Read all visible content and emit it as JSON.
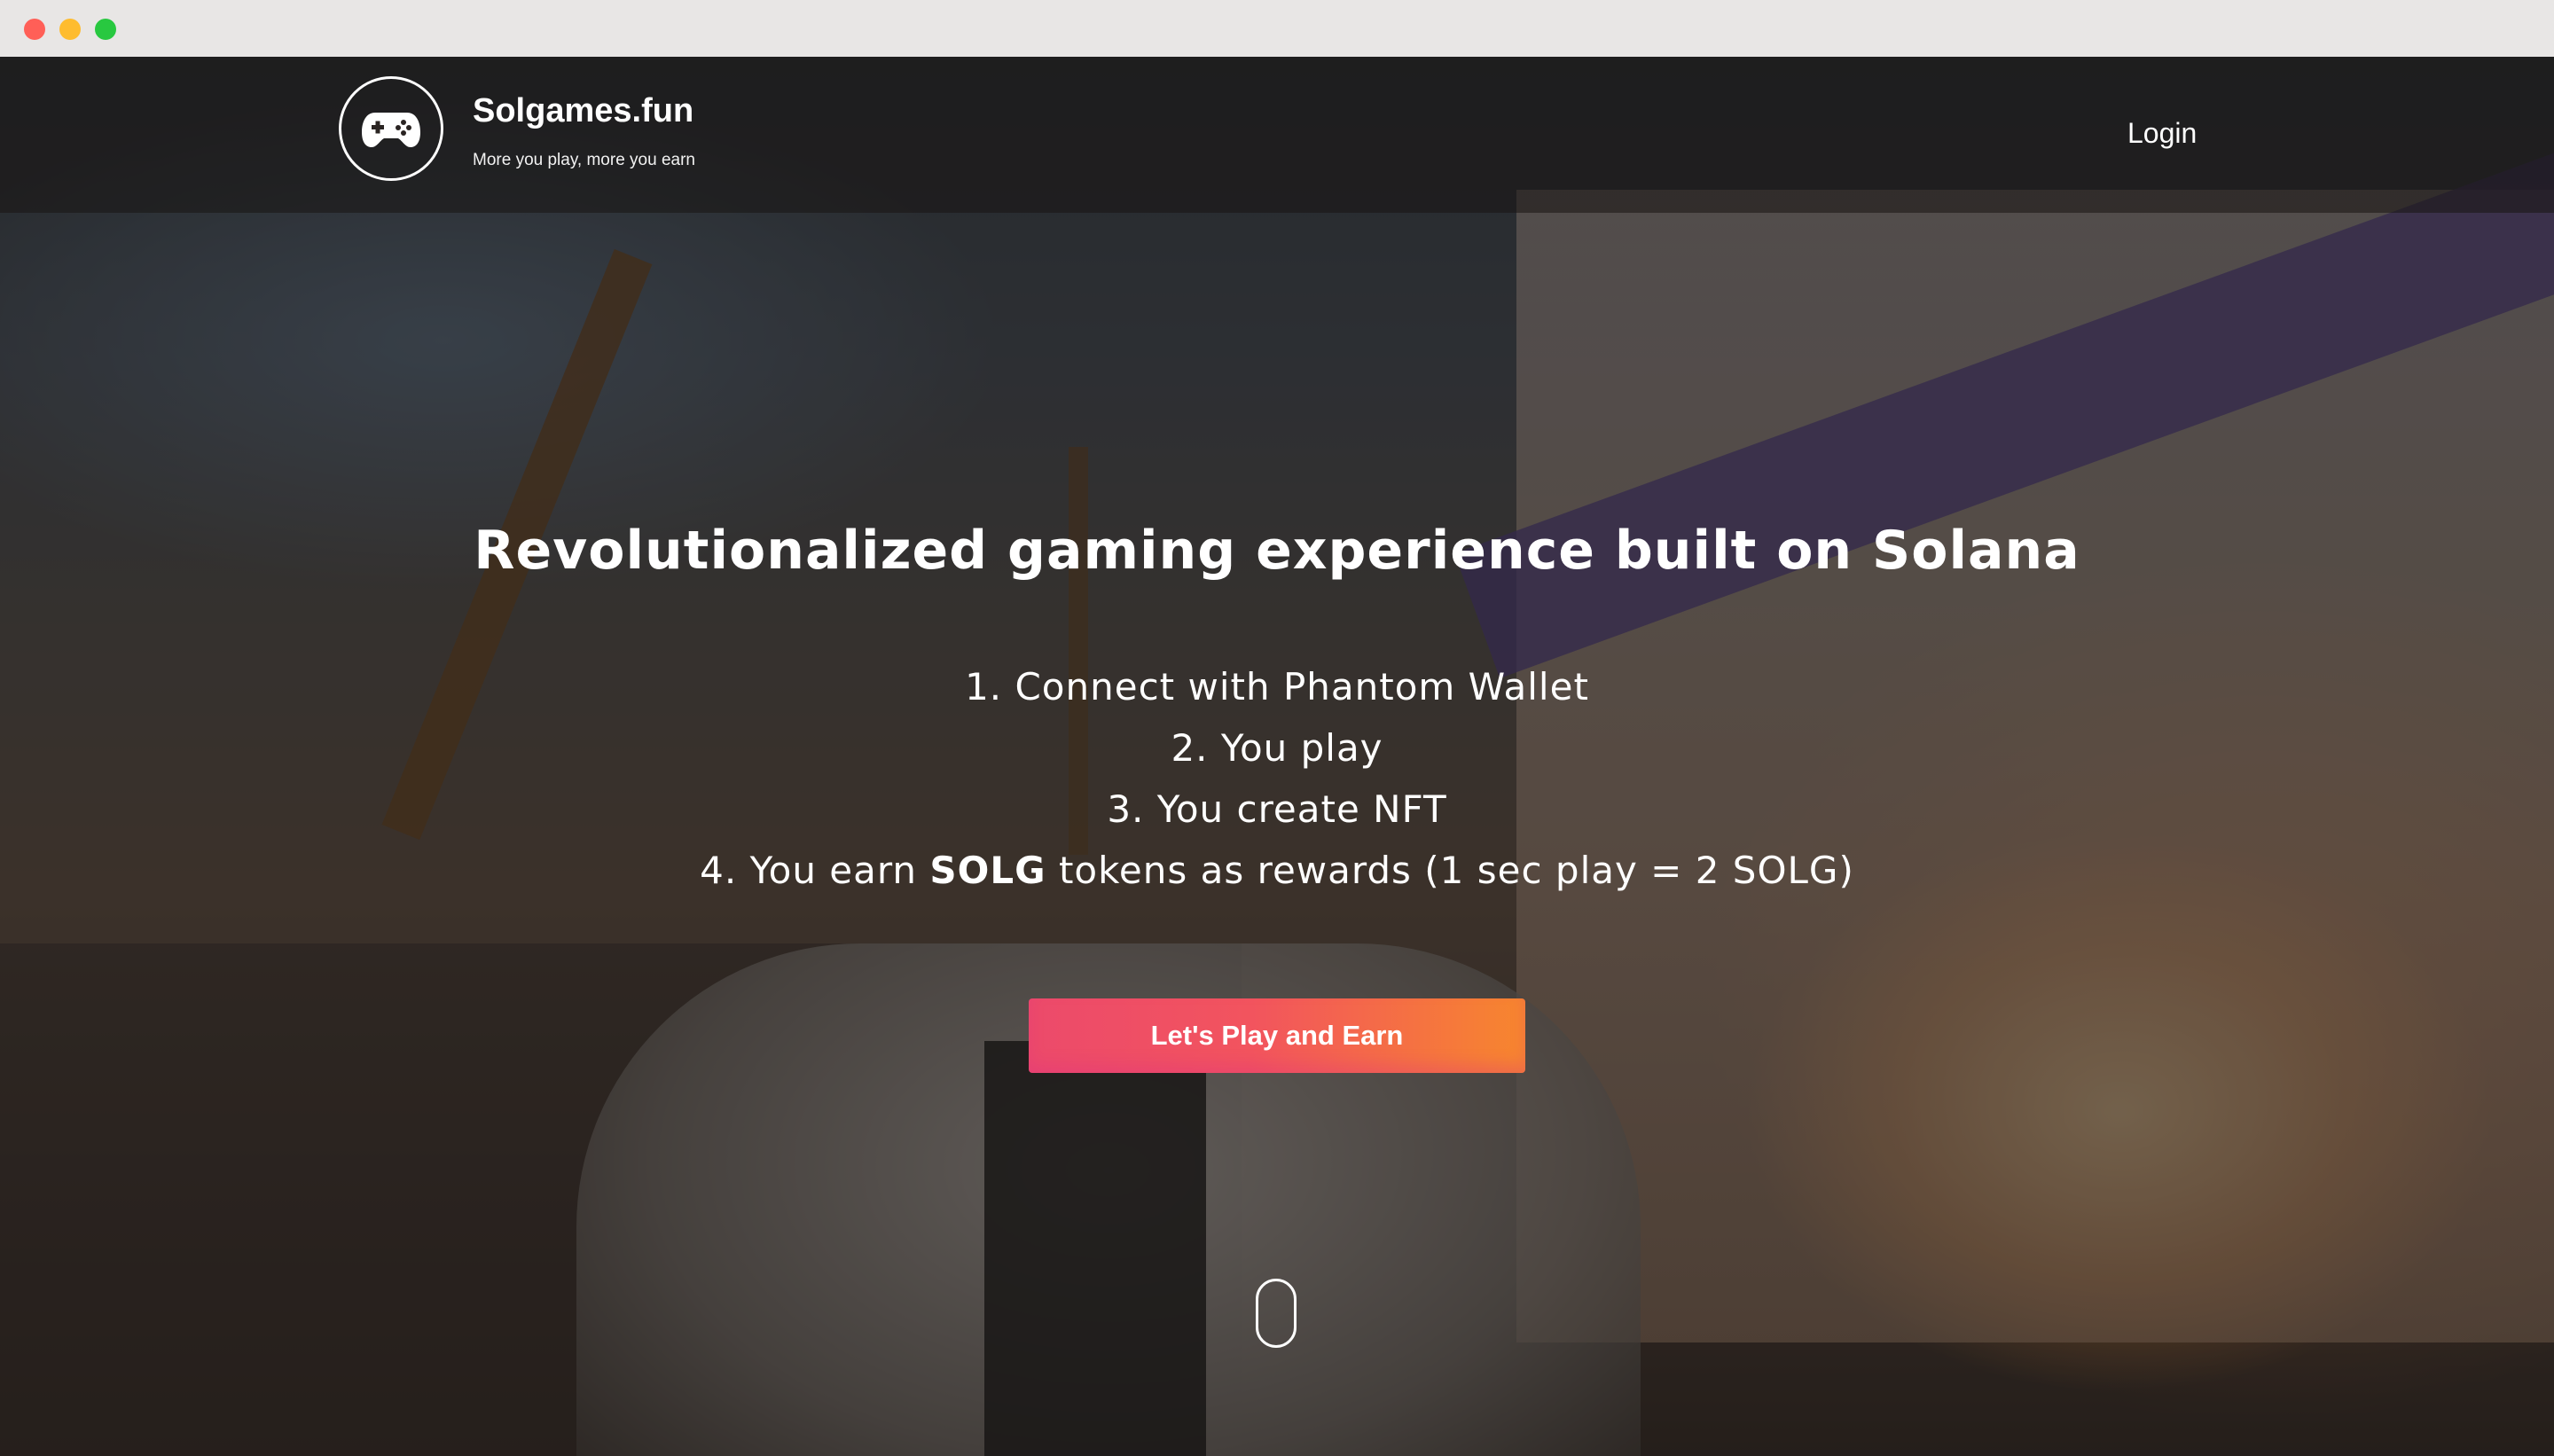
{
  "window": {
    "controls": [
      "close",
      "minimize",
      "maximize"
    ]
  },
  "header": {
    "logo_icon": "gamepad-icon",
    "brand_name": "Solgames.fun",
    "tagline": "More you play, more you earn",
    "login_label": "Login"
  },
  "hero": {
    "headline": "Revolutionalized gaming experience built on Solana",
    "steps": [
      "1. Connect with Phantom Wallet",
      "2. You play",
      "3. You create NFT"
    ],
    "step4": {
      "prefix": "4. You earn ",
      "token": "SOLG",
      "suffix": " tokens as rewards (1 sec play = 2 SOLG)"
    },
    "cta_label": "Let's Play and Earn",
    "scroll_icon": "mouse-scroll-icon"
  },
  "colors": {
    "cta_gradient_start": "#ec4a6b",
    "cta_gradient_end": "#f7862e",
    "text": "#ffffff"
  }
}
